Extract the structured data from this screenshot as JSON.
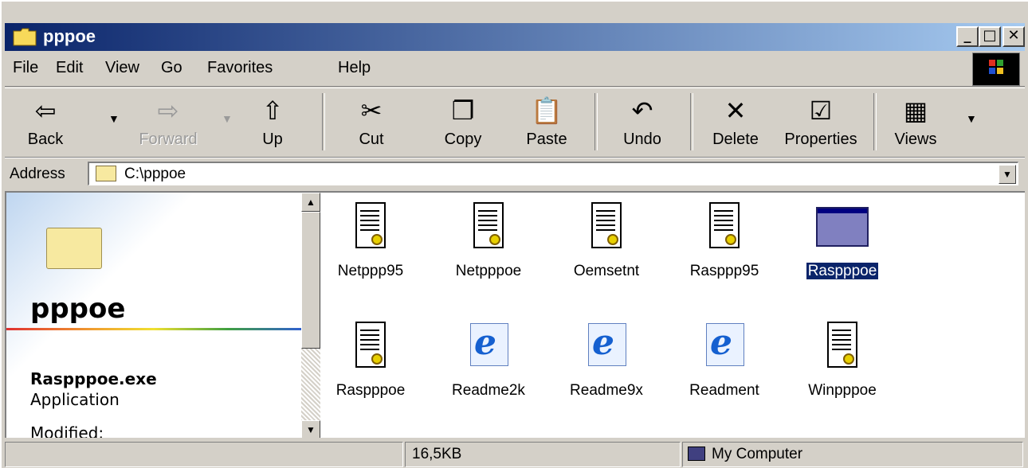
{
  "window": {
    "title": "pppoe",
    "buttons": {
      "minimize": "_",
      "maximize": "□",
      "close": "✕"
    }
  },
  "menu": {
    "items": [
      {
        "label": "File"
      },
      {
        "label": "Edit"
      },
      {
        "label": "View"
      },
      {
        "label": "Go"
      },
      {
        "label": "Favorites"
      },
      {
        "label": "Help"
      }
    ]
  },
  "toolbar": {
    "back": {
      "label": "Back",
      "icon": "arrow-left-icon"
    },
    "forward": {
      "label": "Forward",
      "icon": "arrow-right-icon",
      "disabled": true
    },
    "up": {
      "label": "Up",
      "icon": "up-folder-icon"
    },
    "cut": {
      "label": "Cut",
      "icon": "scissors-icon"
    },
    "copy": {
      "label": "Copy",
      "icon": "copy-icon"
    },
    "paste": {
      "label": "Paste",
      "icon": "paste-icon"
    },
    "undo": {
      "label": "Undo",
      "icon": "undo-icon"
    },
    "delete": {
      "label": "Delete",
      "icon": "delete-icon"
    },
    "properties": {
      "label": "Properties",
      "icon": "properties-icon"
    },
    "views": {
      "label": "Views",
      "icon": "views-icon"
    }
  },
  "address": {
    "label": "Address",
    "value": "C:\\pppoe"
  },
  "leftpane": {
    "folder_name": "pppoe",
    "selected_file": "Raspppoe.exe",
    "selected_type": "Application",
    "modified_label": "Modified:"
  },
  "files": [
    {
      "name": "Netppp95",
      "icon": "inf-document-icon"
    },
    {
      "name": "Netpppoe",
      "icon": "inf-document-icon"
    },
    {
      "name": "Oemsetnt",
      "icon": "inf-document-icon"
    },
    {
      "name": "Rasppp95",
      "icon": "inf-document-icon"
    },
    {
      "name": "Raspppoe",
      "icon": "application-icon",
      "selected": true
    },
    {
      "name": "Raspppoe",
      "icon": "inf-document-icon"
    },
    {
      "name": "Readme2k",
      "icon": "ie-document-icon"
    },
    {
      "name": "Readme9x",
      "icon": "ie-document-icon"
    },
    {
      "name": "Readment",
      "icon": "ie-document-icon"
    },
    {
      "name": "Winpppoe",
      "icon": "inf-document-icon"
    }
  ],
  "statusbar": {
    "size": "16,5KB",
    "zone": "My Computer"
  }
}
